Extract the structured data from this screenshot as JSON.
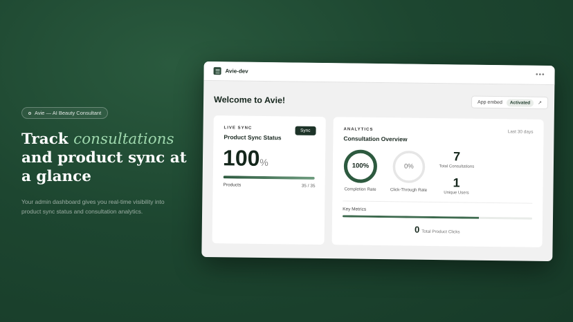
{
  "hero": {
    "pill_text": "Avie — AI Beauty Consultant",
    "headline_pre": "Track ",
    "headline_accent": "consultations",
    "headline_post": " and product sync at a glance",
    "subtext": "Your admin dashboard gives you real-time visibility into product sync status and consultation analytics."
  },
  "app": {
    "name": "Avie-dev",
    "more_label": "•••",
    "welcome": "Welcome to Avie!",
    "embed": {
      "label": "App embed",
      "status": "Activated",
      "arrow": "↗"
    }
  },
  "sync_card": {
    "eyebrow": "LIVE SYNC",
    "title": "Product Sync Status",
    "button": "Sync",
    "percent_value": "100",
    "percent_sign": "%",
    "progress": 1.0,
    "row_label": "Products",
    "row_value": "35 / 35"
  },
  "analytics_card": {
    "eyebrow": "ANALYTICS",
    "title": "Consultation Overview",
    "period": "Last 30 days",
    "completion": {
      "value_text": "100%",
      "fraction": 1.0,
      "label": "Completion Rate"
    },
    "ctr": {
      "value_text": "0%",
      "fraction": 0.0,
      "label": "Click-Through Rate"
    },
    "total_consultations": {
      "value": "7",
      "label": "Total Consultations"
    },
    "unique_users": {
      "value": "1",
      "label": "Unique Users"
    },
    "key_metrics_label": "Key Metrics",
    "key_metrics_fraction": 0.72,
    "product_clicks": {
      "value": "0",
      "label": "Total Product Clicks"
    }
  },
  "colors": {
    "accent": "#9fd8ae",
    "brand_dark": "#1d3328",
    "ring_green": "#2d5a3f"
  }
}
